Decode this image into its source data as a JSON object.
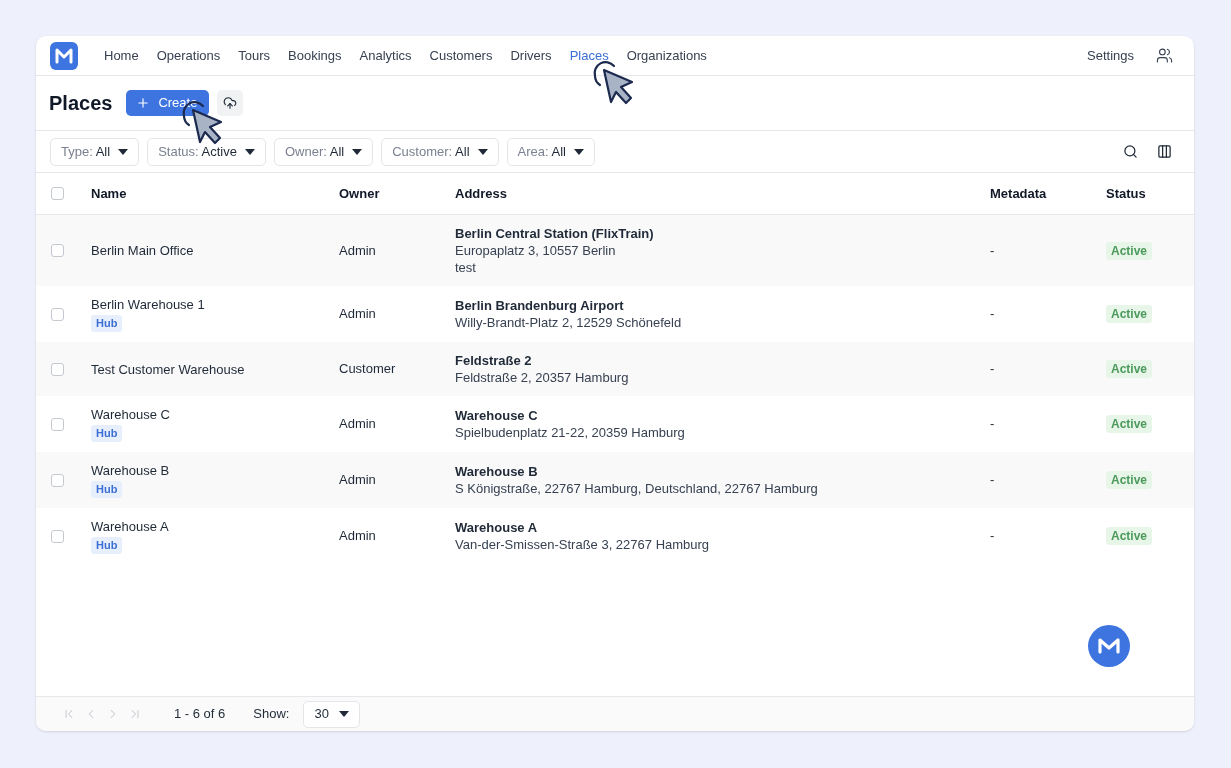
{
  "nav": {
    "items": [
      {
        "label": "Home",
        "selected": false
      },
      {
        "label": "Operations",
        "selected": false
      },
      {
        "label": "Tours",
        "selected": false
      },
      {
        "label": "Bookings",
        "selected": false
      },
      {
        "label": "Analytics",
        "selected": false
      },
      {
        "label": "Customers",
        "selected": false
      },
      {
        "label": "Drivers",
        "selected": false
      },
      {
        "label": "Places",
        "selected": true
      },
      {
        "label": "Organizations",
        "selected": false
      }
    ],
    "settings": "Settings"
  },
  "header": {
    "title": "Places",
    "create_button": "Create"
  },
  "filters": [
    {
      "label": "Type:",
      "value": "All"
    },
    {
      "label": "Status:",
      "value": "Active"
    },
    {
      "label": "Owner:",
      "value": "All"
    },
    {
      "label": "Customer:",
      "value": "All"
    },
    {
      "label": "Area:",
      "value": "All"
    }
  ],
  "table": {
    "select_all_checked": false,
    "columns": [
      "Name",
      "Owner",
      "Address",
      "Metadata",
      "Status"
    ],
    "rows": [
      {
        "checked": false,
        "name": "Berlin Main Office",
        "owner": "Admin",
        "address_title": "Berlin Central Station (FlixTrain)",
        "address_lines": [
          "Europaplatz 3, 10557 Berlin",
          "test"
        ],
        "metadata": "-",
        "status": "Active"
      },
      {
        "checked": false,
        "name": "Berlin Warehouse 1",
        "tags": [
          "Hub"
        ],
        "owner": "Admin",
        "address_title": "Berlin Brandenburg Airport",
        "address_lines": [
          "Willy-Brandt-Platz 2, 12529 Schönefeld"
        ],
        "metadata": "-",
        "status": "Active"
      },
      {
        "checked": false,
        "name": "Test Customer Warehouse",
        "owner": "Customer",
        "address_title": "Feldstraße 2",
        "address_lines": [
          "Feldstraße 2, 20357 Hamburg"
        ],
        "metadata": "-",
        "status": "Active"
      },
      {
        "checked": false,
        "name": "Warehouse C",
        "tags": [
          "Hub"
        ],
        "owner": "Admin",
        "address_title": "Warehouse C",
        "address_lines": [
          "Spielbudenplatz 21-22, 20359 Hamburg"
        ],
        "metadata": "-",
        "status": "Active"
      },
      {
        "checked": false,
        "name": "Warehouse B",
        "tags": [
          "Hub"
        ],
        "owner": "Admin",
        "address_title": "Warehouse B",
        "address_lines": [
          "S Königstraße, 22767 Hamburg, Deutschland, 22767 Hamburg"
        ],
        "metadata": "-",
        "status": "Active"
      },
      {
        "checked": false,
        "name": "Warehouse A",
        "tags": [
          "Hub"
        ],
        "owner": "Admin",
        "address_title": "Warehouse A",
        "address_lines": [
          "Van-der-Smissen-Straße 3, 22767 Hamburg"
        ],
        "metadata": "-",
        "status": "Active"
      }
    ]
  },
  "pagination": {
    "nav_buttons": [
      {
        "kind": "first",
        "disabled": true
      },
      {
        "kind": "prev",
        "disabled": true
      },
      {
        "kind": "next",
        "disabled": true
      },
      {
        "kind": "last",
        "disabled": true
      }
    ],
    "range": "1 - 6 of 6",
    "show_label": "Show:",
    "page_size": "30"
  }
}
